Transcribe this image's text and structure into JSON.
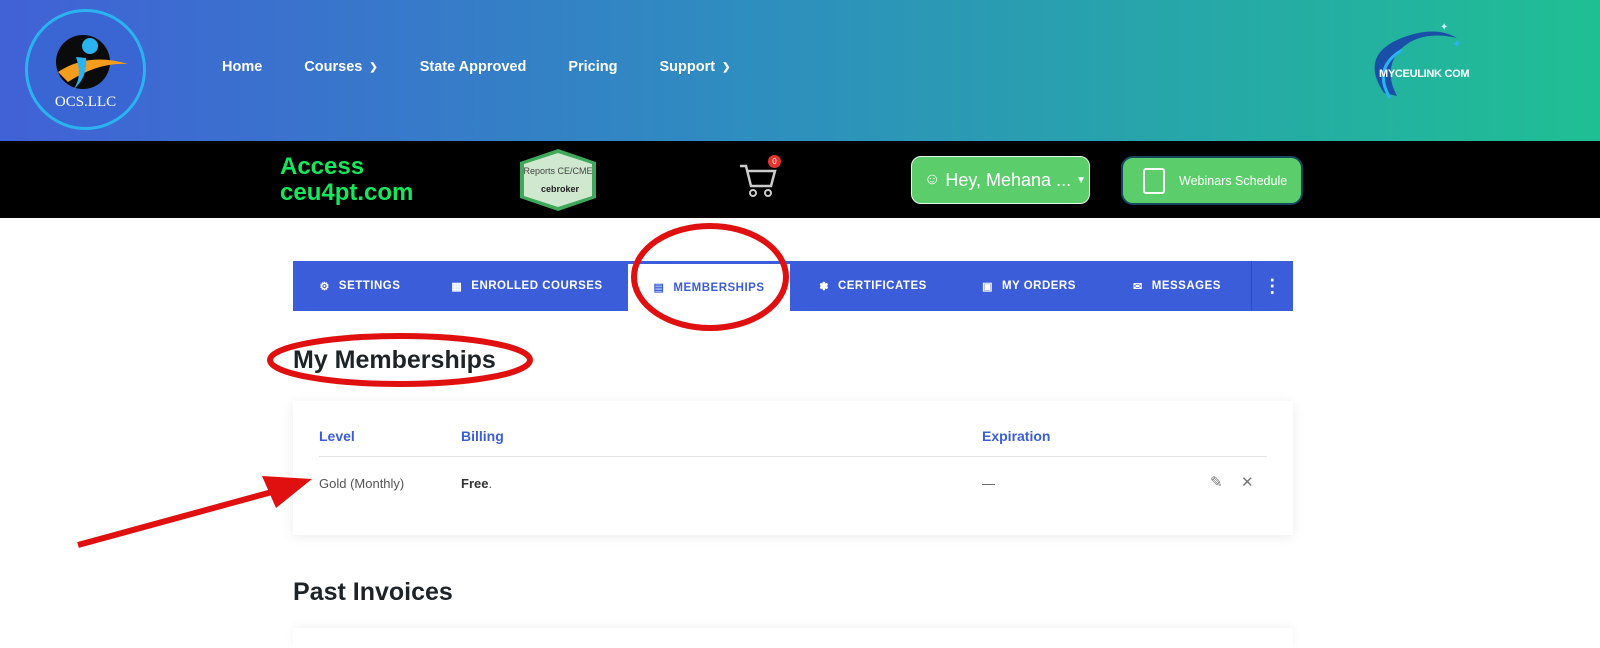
{
  "header": {
    "logo_text": "OCS.LLC",
    "nav": [
      {
        "label": "Home",
        "has_dropdown": false
      },
      {
        "label": "Courses",
        "has_dropdown": true
      },
      {
        "label": "State Approved",
        "has_dropdown": false
      },
      {
        "label": "Pricing",
        "has_dropdown": false
      },
      {
        "label": "Support",
        "has_dropdown": true
      }
    ],
    "brand_text": "MYCEULINK COM"
  },
  "promo_bar": {
    "access_line1": "Access",
    "access_line2": "ceu4pt.com",
    "badge_text": "Reports CE/CME",
    "badge_brand": "cebroker",
    "cart_count": "0",
    "user_greeting": "Hey, Mehana ...",
    "webinars_label": "Webinars Schedule"
  },
  "tabs": [
    {
      "label": "SETTINGS",
      "icon": "gear-icon",
      "active": false
    },
    {
      "label": "ENROLLED COURSES",
      "icon": "book-icon",
      "active": false
    },
    {
      "label": "MEMBERSHIPS",
      "icon": "id-card-icon",
      "active": true
    },
    {
      "label": "CERTIFICATES",
      "icon": "medal-icon",
      "active": false
    },
    {
      "label": "MY ORDERS",
      "icon": "basket-icon",
      "active": false
    },
    {
      "label": "MESSAGES",
      "icon": "envelope-icon",
      "active": false
    }
  ],
  "memberships": {
    "title": "My Memberships",
    "columns": [
      "Level",
      "Billing",
      "Expiration"
    ],
    "rows": [
      {
        "level": "Gold (Monthly)",
        "billing": "Free",
        "billing_suffix": ".",
        "expiration": "—"
      }
    ]
  },
  "past_invoices": {
    "title": "Past Invoices"
  },
  "colors": {
    "accent": "#3b5dd9",
    "header_gradient_start": "#4161d6",
    "header_gradient_end": "#1fbf94",
    "green": "#5bce6b",
    "annotation_red": "#e01010"
  }
}
